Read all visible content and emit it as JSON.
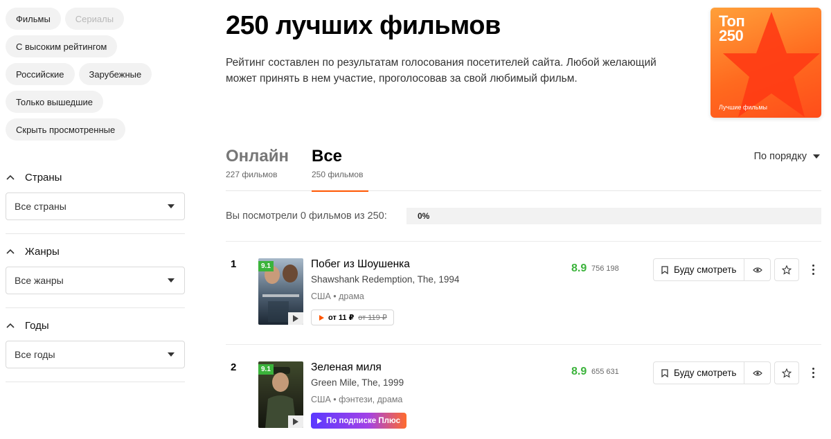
{
  "sidebar": {
    "chips": [
      [
        {
          "label": "Фильмы",
          "disabled": false
        },
        {
          "label": "Сериалы",
          "disabled": true
        }
      ],
      [
        {
          "label": "С высоким рейтингом",
          "disabled": false
        }
      ],
      [
        {
          "label": "Российские",
          "disabled": false
        },
        {
          "label": "Зарубежные",
          "disabled": false
        }
      ],
      [
        {
          "label": "Только вышедшие",
          "disabled": false
        }
      ],
      [
        {
          "label": "Скрыть просмотренные",
          "disabled": false
        }
      ]
    ],
    "filters": [
      {
        "title": "Страны",
        "value": "Все страны"
      },
      {
        "title": "Жанры",
        "value": "Все жанры"
      },
      {
        "title": "Годы",
        "value": "Все годы"
      }
    ]
  },
  "header": {
    "title": "250 лучших фильмов",
    "description": "Рейтинг составлен по результатам голосования посетителей сайта. Любой желающий может принять в нем участие, проголосовав за свой любимый фильм."
  },
  "badge": {
    "top_line1": "Топ",
    "top_line2": "250",
    "subtitle": "Лучшие фильмы",
    "colors": {
      "from": "#ffa03a",
      "to": "#ff4d1a",
      "star": "#ff3b14"
    }
  },
  "tabs": [
    {
      "label": "Онлайн",
      "count": "227 фильмов",
      "active": false
    },
    {
      "label": "Все",
      "count": "250 фильмов",
      "active": true
    }
  ],
  "sort": {
    "label": "По порядку"
  },
  "watched": {
    "text": "Вы посмотрели 0 фильмов из 250:",
    "percent_label": "0%",
    "progress": 0
  },
  "films": [
    {
      "rank": "1",
      "poster_rating": "9.1",
      "title": "Побег из Шоушенка",
      "original": "Shawshank Redemption, The, 1994",
      "meta": "США • драма",
      "offer_type": "price",
      "price": "от 11 ₽",
      "old_price": "от 119 ₽",
      "score": "8.9",
      "votes": "756 198",
      "watch_label": "Буду смотреть"
    },
    {
      "rank": "2",
      "poster_rating": "9.1",
      "title": "Зеленая миля",
      "original": "Green Mile, The, 1999",
      "meta": "США • фэнтези, драма",
      "offer_type": "plus",
      "plus_label": "По подписке Плюс",
      "score": "8.9",
      "votes": "655 631",
      "watch_label": "Буду смотреть"
    }
  ],
  "colors": {
    "accent": "#ff5500",
    "score_green": "#3bb33b"
  }
}
